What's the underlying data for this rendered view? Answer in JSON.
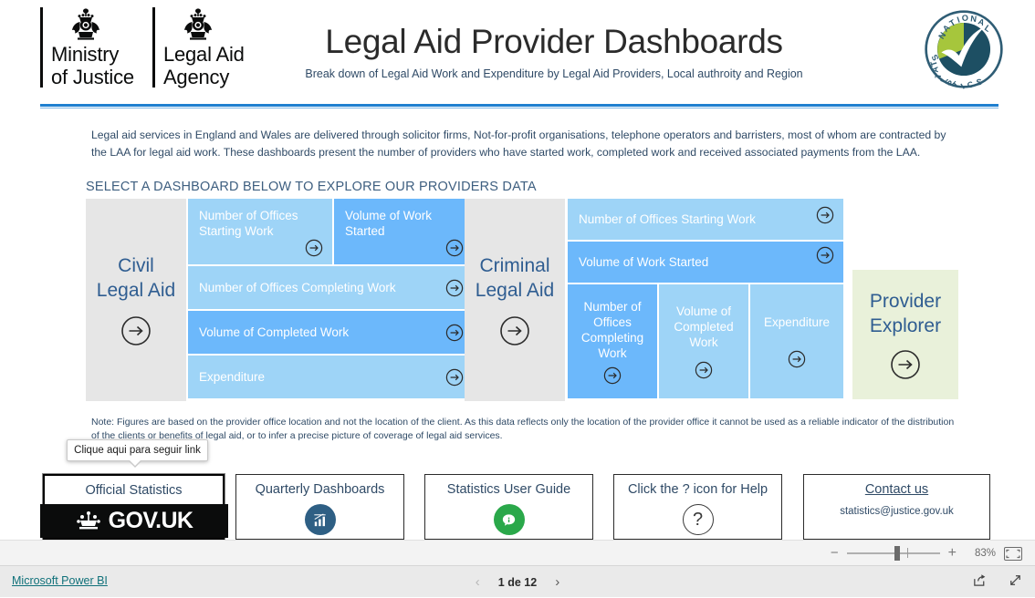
{
  "header": {
    "moj_logo_line1": "Ministry\nof Justice",
    "moj_logo_line2": "Legal Aid\nAgency",
    "title": "Legal Aid Provider Dashboards",
    "subtitle": "Break down of Legal Aid Work and Expenditure by Legal Aid Providers, Local authroity and Region",
    "national_statistics_top": "NATIONAL",
    "national_statistics_bottom": "STATISTICS"
  },
  "intro": {
    "paragraph": "Legal aid services in England and Wales are delivered through solicitor firms, Not-for-profit organisations, telephone operators and barristers, most of whom are contracted by the LAA for legal aid work. These dashboards present the number of providers who have started work, completed work and received associated payments from the LAA.",
    "select_heading": "SELECT A DASHBOARD BELOW TO EXPLORE OUR PROVIDERS DATA"
  },
  "tiles": {
    "civil_group_label": "Civil\nLegal Aid",
    "criminal_group_label": "Criminal\nLegal Aid",
    "provider_explorer_label": "Provider\nExplorer",
    "civil": [
      {
        "label": "Number of Offices Starting Work",
        "shade": "light"
      },
      {
        "label": "Volume of Work Started",
        "shade": "dark"
      },
      {
        "label": "Number of Offices Completing Work",
        "shade": "light"
      },
      {
        "label": "Volume of Completed Work",
        "shade": "dark"
      },
      {
        "label": "Expenditure",
        "shade": "light"
      }
    ],
    "criminal": [
      {
        "label": "Number of Offices Starting Work",
        "shade": "light"
      },
      {
        "label": "Volume of Work Started",
        "shade": "dark"
      },
      {
        "label": "Number of Offices Completing Work",
        "shade": "dark"
      },
      {
        "label": "Volume of Completed Work",
        "shade": "light"
      },
      {
        "label": "Expenditure",
        "shade": "light"
      }
    ],
    "arrow_icon": "→"
  },
  "note": {
    "text": "Note: Figures are based on the provider office location and not the location of the client. As this data reflects only the location of the provider office it cannot be used as a reliable indicator of the distribution of the clients or benefits of legal aid, or to infer a precise picture of coverage of legal aid services."
  },
  "tooltip": {
    "text": "Clique aqui para seguir link"
  },
  "buttons": [
    {
      "title": "Official Statistics",
      "badge": "GOV.UK",
      "selected": true
    },
    {
      "title": "Quarterly Dashboards",
      "icon": "bar-chart-icon",
      "selected": false
    },
    {
      "title": "Statistics User Guide",
      "icon": "info-bubble-icon",
      "selected": false
    },
    {
      "title": "Click the ? icon for Help",
      "icon": "question-mark-icon",
      "selected": false
    },
    {
      "title": "Contact us",
      "subtitle": "statistics@justice.gov.uk",
      "selected": false
    }
  ],
  "zoombar": {
    "minus": "−",
    "plus": "+",
    "percent": "83%",
    "fit_icon": "fit-to-page-icon"
  },
  "navbar": {
    "powerbi_link": "Microsoft Power BI",
    "prev_icon": "‹",
    "page_label": "1 de 12",
    "next_icon": "›",
    "share_icon": "share-icon",
    "fullscreen_icon": "fullscreen-icon"
  },
  "colors": {
    "tile_light_blue": "#9ed4f7",
    "tile_dark_blue": "#6cb8fb",
    "group_gray": "#e6e6e6",
    "group_green": "#e9f1da",
    "rule_blue": "#1f7fd0",
    "text_blue": "#2f4a66",
    "link_teal": "#10717a"
  }
}
